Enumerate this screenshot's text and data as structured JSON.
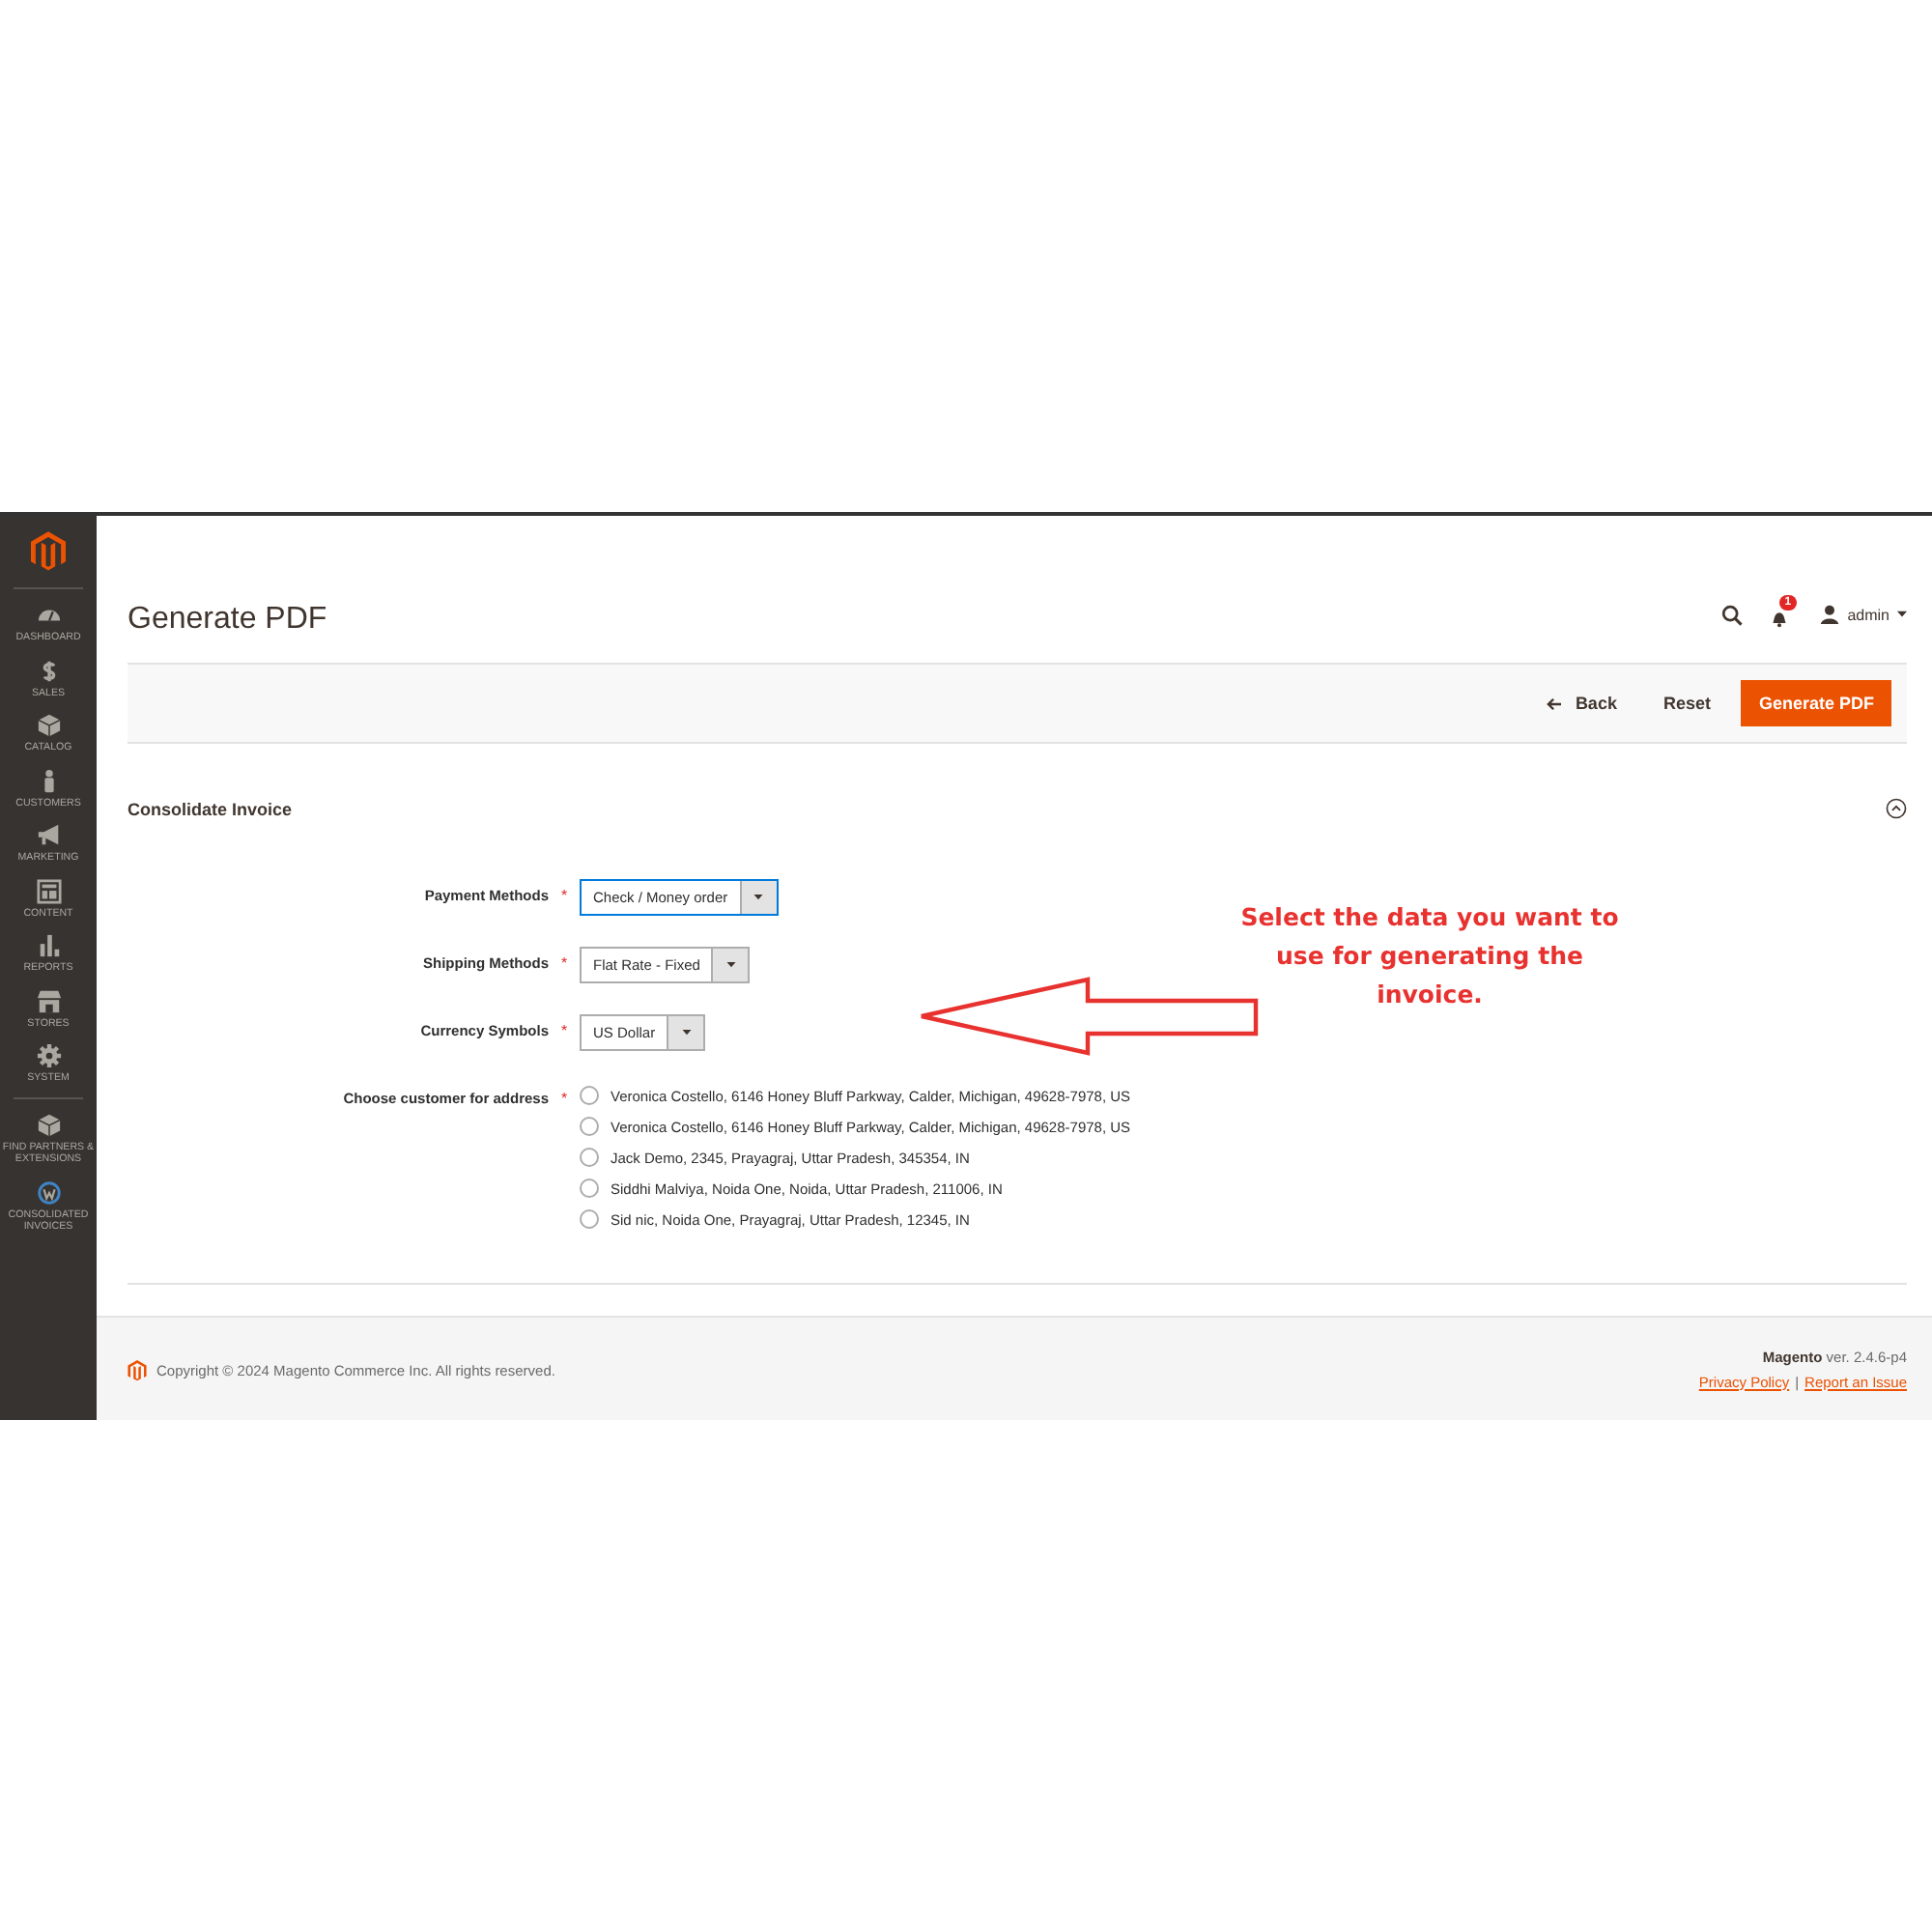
{
  "sidebar": {
    "items": [
      {
        "kind": "dashboard",
        "label": "DASHBOARD"
      },
      {
        "kind": "sales",
        "label": "SALES"
      },
      {
        "kind": "catalog",
        "label": "CATALOG"
      },
      {
        "kind": "customers",
        "label": "CUSTOMERS"
      },
      {
        "kind": "marketing",
        "label": "MARKETING"
      },
      {
        "kind": "content",
        "label": "CONTENT"
      },
      {
        "kind": "reports",
        "label": "REPORTS"
      },
      {
        "kind": "stores",
        "label": "STORES"
      },
      {
        "kind": "system",
        "label": "SYSTEM"
      },
      {
        "kind": "partners",
        "label": "FIND PARTNERS & EXTENSIONS"
      },
      {
        "kind": "invoices",
        "label": "CONSOLIDATED INVOICES"
      }
    ]
  },
  "header": {
    "title": "Generate PDF",
    "notifications": "1",
    "user": "admin"
  },
  "actions": {
    "back": "Back",
    "reset": "Reset",
    "primary": "Generate PDF"
  },
  "section": {
    "title": "Consolidate Invoice",
    "expanded": true,
    "fields": [
      {
        "kind": "select",
        "label": "Payment Methods",
        "required_mark": "*",
        "value": "Check / Money order",
        "focused": true
      },
      {
        "kind": "select",
        "label": "Shipping Methods",
        "required_mark": "*",
        "value": "Flat Rate - Fixed",
        "focused": false
      },
      {
        "kind": "select",
        "label": "Currency Symbols",
        "required_mark": "*",
        "value": "US Dollar",
        "focused": false
      },
      {
        "kind": "radio",
        "label": "Choose customer for address",
        "required_mark": "*",
        "options": [
          {
            "label": "Veronica Costello, 6146 Honey Bluff Parkway, Calder, Michigan, 49628-7978, US",
            "selected": false
          },
          {
            "label": "Veronica Costello, 6146 Honey Bluff Parkway, Calder, Michigan, 49628-7978, US",
            "selected": false
          },
          {
            "label": "Jack Demo, 2345, Prayagraj, Uttar Pradesh, 345354, IN",
            "selected": false
          },
          {
            "label": "Siddhi Malviya, Noida One, Noida, Uttar Pradesh, 211006, IN",
            "selected": false
          },
          {
            "label": "Sid nic, Noida One, Prayagraj, Uttar Pradesh, 12345, IN",
            "selected": false
          }
        ]
      }
    ]
  },
  "annotation": {
    "text": "Select the data you want to use for generating the invoice."
  },
  "footer": {
    "copyright": "Copyright © 2024 Magento Commerce Inc. All rights reserved.",
    "brand": "Magento",
    "version": "ver. 2.4.6-p4",
    "links": [
      "Privacy Policy",
      "Report an Issue"
    ],
    "separator": "|"
  }
}
